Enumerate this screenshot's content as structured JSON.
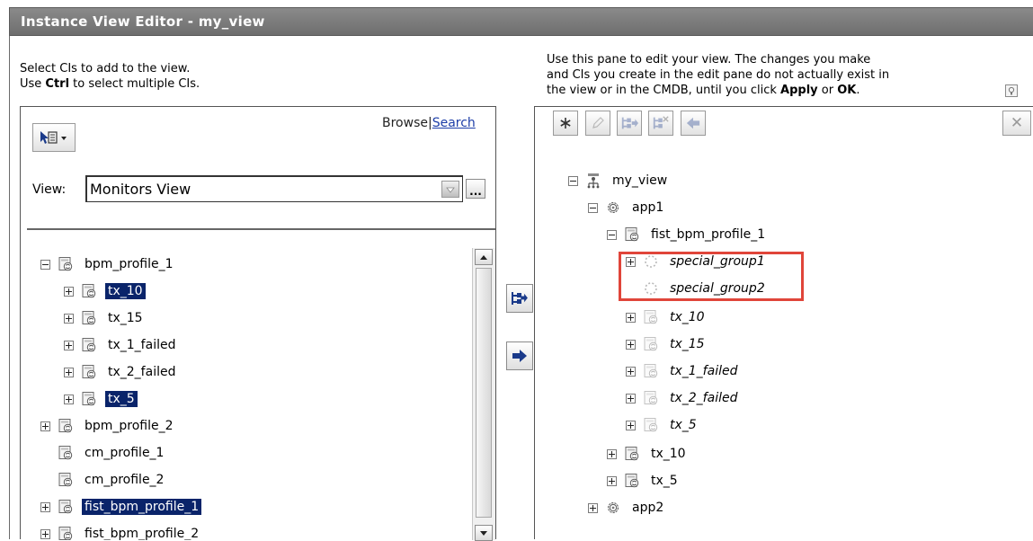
{
  "window": {
    "title": "Instance View Editor - my_view"
  },
  "left": {
    "instructions": {
      "line1": "Select CIs to add to the view.",
      "line2_pre": "Use ",
      "line2_key": "Ctrl",
      "line2_post": " to select multiple CIs."
    },
    "mode_links": {
      "browse": "Browse",
      "separator": "|",
      "search": "Search"
    },
    "view_label": "View:",
    "view_value": "Monitors View",
    "browse_button": "...",
    "tree": [
      {
        "label": "bpm_profile_1",
        "expander": "minus",
        "selected": false
      },
      {
        "label": "tx_10",
        "expander": "plus",
        "selected": true
      },
      {
        "label": "tx_15",
        "expander": "plus",
        "selected": false
      },
      {
        "label": "tx_1_failed",
        "expander": "plus",
        "selected": false
      },
      {
        "label": "tx_2_failed",
        "expander": "plus",
        "selected": false
      },
      {
        "label": "tx_5",
        "expander": "plus",
        "selected": true
      },
      {
        "label": "bpm_profile_2",
        "expander": "plus",
        "selected": false
      },
      {
        "label": "cm_profile_1",
        "expander": "none",
        "selected": false
      },
      {
        "label": "cm_profile_2",
        "expander": "none",
        "selected": false
      },
      {
        "label": "fist_bpm_profile_1",
        "expander": "plus",
        "selected": true
      },
      {
        "label": "fist_bpm_profile_2",
        "expander": "plus",
        "selected": false
      }
    ]
  },
  "right": {
    "instructions": {
      "line1": "Use this pane to edit your view. The changes you make",
      "line2": "and CIs you create in the edit pane do not actually exist in",
      "line3_pre": "the view or in the CMDB, until you click ",
      "line3_apply": "Apply",
      "line3_mid": " or ",
      "line3_ok": "OK",
      "line3_post": "."
    },
    "toolbar_close": "✕",
    "tree": [
      {
        "label": "my_view",
        "expander": "minus",
        "icon": "view-icon",
        "italic": false
      },
      {
        "label": "app1",
        "expander": "minus",
        "icon": "gear-icon",
        "italic": false
      },
      {
        "label": "fist_bpm_profile_1",
        "expander": "minus",
        "icon": "profile-icon",
        "italic": false
      },
      {
        "label": "special_group1",
        "expander": "plus",
        "icon": "group-icon",
        "italic": true
      },
      {
        "label": "special_group2",
        "expander": "none",
        "icon": "group-icon",
        "italic": true
      },
      {
        "label": "tx_10",
        "expander": "plus",
        "icon": "profile-icon-faded",
        "italic": true
      },
      {
        "label": "tx_15",
        "expander": "plus",
        "icon": "profile-icon-faded",
        "italic": true
      },
      {
        "label": "tx_1_failed",
        "expander": "plus",
        "icon": "profile-icon-faded",
        "italic": true
      },
      {
        "label": "tx_2_failed",
        "expander": "plus",
        "icon": "profile-icon-faded",
        "italic": true
      },
      {
        "label": "tx_5",
        "expander": "plus",
        "icon": "profile-icon-faded",
        "italic": true
      },
      {
        "label": "tx_10",
        "expander": "plus",
        "icon": "profile-icon",
        "italic": false
      },
      {
        "label": "tx_5",
        "expander": "plus",
        "icon": "profile-icon",
        "italic": false
      },
      {
        "label": "app2",
        "expander": "plus",
        "icon": "gear-icon",
        "italic": false
      }
    ]
  },
  "colors": {
    "selection": "#0a246a",
    "highlight_box": "#e0453a",
    "titlebar": "#7c7c7c",
    "link": "#1d3ea8"
  }
}
